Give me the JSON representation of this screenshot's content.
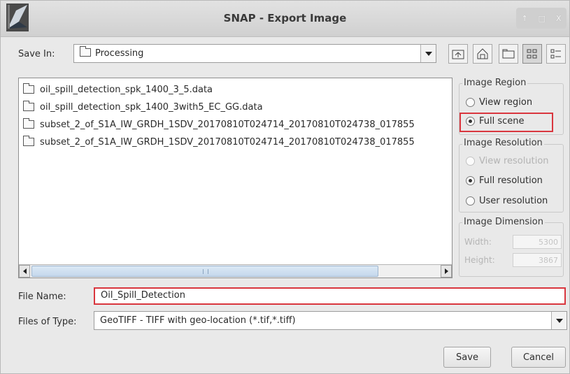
{
  "window": {
    "title": "SNAP - Export Image",
    "controls": [
      "↑",
      "□",
      "X"
    ]
  },
  "save_in": {
    "label": "Save In:",
    "value": "Processing"
  },
  "toolbar": {
    "icons": [
      "up-one-level-icon",
      "home-icon",
      "new-folder-icon",
      "list-view-icon",
      "details-view-icon"
    ]
  },
  "files": [
    {
      "name": "oil_spill_detection_spk_1400_3_5.data"
    },
    {
      "name": "oil_spill_detection_spk_1400_3with5_EC_GG.data"
    },
    {
      "name": "subset_2_of_S1A_IW_GRDH_1SDV_20170810T024714_20170810T024738_017855"
    },
    {
      "name": "subset_2_of_S1A_IW_GRDH_1SDV_20170810T024714_20170810T024738_017855"
    }
  ],
  "image_region": {
    "title": "Image Region",
    "options": [
      {
        "label": "View region",
        "selected": false
      },
      {
        "label": "Full scene",
        "selected": true
      }
    ]
  },
  "image_resolution": {
    "title": "Image Resolution",
    "options": [
      {
        "label": "View resolution",
        "selected": false,
        "disabled": true
      },
      {
        "label": "Full resolution",
        "selected": true
      },
      {
        "label": "User resolution",
        "selected": false
      }
    ]
  },
  "image_dimension": {
    "title": "Image Dimension",
    "width_label": "Width:",
    "width_value": "5300",
    "height_label": "Height:",
    "height_value": "3867"
  },
  "file_name": {
    "label": "File Name:",
    "value": "Oil_Spill_Detection"
  },
  "file_type": {
    "label": "Files of Type:",
    "value": "GeoTIFF - TIFF with geo-location (*.tif,*.tiff)"
  },
  "buttons": {
    "save": "Save",
    "cancel": "Cancel"
  },
  "colors": {
    "highlight": "#d9363e",
    "scroll_thumb": "#c5d8ec"
  }
}
